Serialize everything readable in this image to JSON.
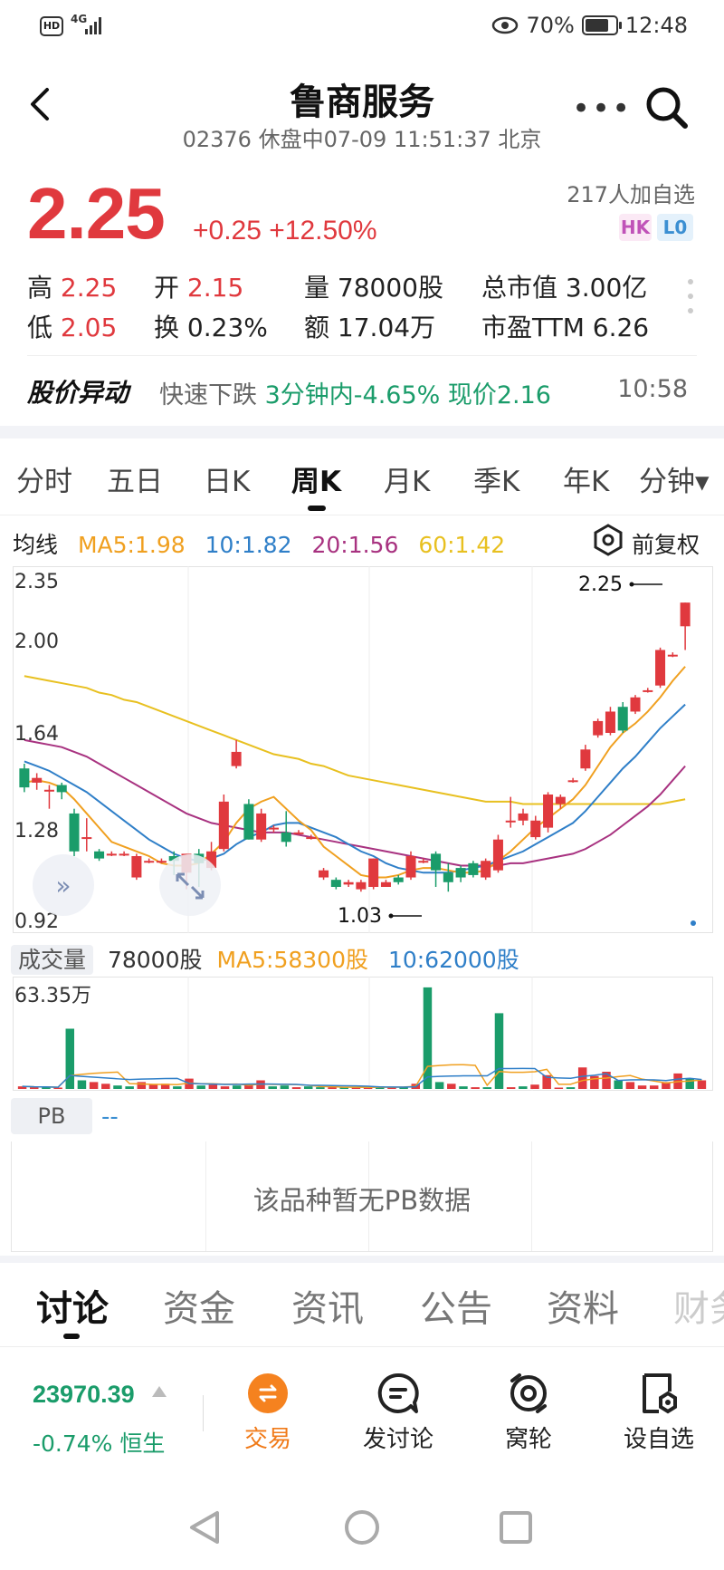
{
  "status_bar": {
    "hd": "HD",
    "network": "4G",
    "battery": "70%",
    "time": "12:48"
  },
  "header": {
    "title": "鲁商服务",
    "code": "02376",
    "trading_status": "休盘中07-09 11:51:37 北京"
  },
  "quote": {
    "price": "2.25",
    "change": "+0.25",
    "change_pct": "+12.50%",
    "watchers": "217人加自选",
    "tag_hk": "HK",
    "tag_lo": "L0",
    "high_label": "高",
    "high": "2.25",
    "open_label": "开",
    "open": "2.15",
    "volume_label": "量",
    "volume": "78000股",
    "mktcap_label": "总市值",
    "mktcap": "3.00亿",
    "low_label": "低",
    "low": "2.05",
    "turnover_label": "换",
    "turnover": "0.23%",
    "amount_label": "额",
    "amount": "17.04万",
    "pe_label": "市盈TTM",
    "pe": "6.26"
  },
  "alert": {
    "title": "股价异动",
    "type": "快速下跌",
    "detail": "3分钟内-4.65% 现价2.16",
    "time": "10:58"
  },
  "period_tabs": [
    "分时",
    "五日",
    "日K",
    "周K",
    "月K",
    "季K",
    "年K",
    "分钟▾"
  ],
  "active_period": "周K",
  "ma": {
    "label": "均线",
    "ma5": "MA5:1.98",
    "ma10": "10:1.82",
    "ma20": "20:1.56",
    "ma60": "60:1.42",
    "adjust": "前复权"
  },
  "colors": {
    "up": "#e0393e",
    "down": "#1a9c6a",
    "ma5": "#f0a020",
    "ma10": "#2f7fc8",
    "ma20": "#a83280",
    "ma60": "#e8c020"
  },
  "kline": {
    "y_labels": [
      "2.35",
      "2.00",
      "1.64",
      "1.28",
      "0.92"
    ],
    "high_marker": "2.25",
    "low_marker": "1.03",
    "ylim": [
      0.92,
      2.35
    ],
    "candles": [
      [
        1.55,
        1.47,
        1.57,
        1.45
      ],
      [
        1.49,
        1.51,
        1.53,
        1.46
      ],
      [
        1.46,
        1.46,
        1.48,
        1.38
      ],
      [
        1.48,
        1.45,
        1.49,
        1.42
      ],
      [
        1.36,
        1.2,
        1.38,
        1.18
      ],
      [
        1.26,
        1.26,
        1.34,
        1.2
      ],
      [
        1.2,
        1.17,
        1.21,
        1.16
      ],
      [
        1.19,
        1.19,
        1.2,
        1.18
      ],
      [
        1.19,
        1.19,
        1.2,
        1.18
      ],
      [
        1.09,
        1.18,
        1.19,
        1.08
      ],
      [
        1.16,
        1.16,
        1.17,
        1.15
      ],
      [
        1.16,
        1.16,
        1.17,
        1.15
      ],
      [
        1.18,
        1.16,
        1.2,
        1.1
      ],
      [
        1.11,
        1.19,
        1.19,
        1.04
      ],
      [
        1.19,
        1.15,
        1.21,
        1.05
      ],
      [
        1.13,
        1.2,
        1.24,
        1.12
      ],
      [
        1.21,
        1.41,
        1.44,
        1.2
      ],
      [
        1.56,
        1.62,
        1.67,
        1.55
      ],
      [
        1.4,
        1.25,
        1.42,
        1.25
      ],
      [
        1.25,
        1.36,
        1.38,
        1.24
      ],
      [
        1.3,
        1.3,
        1.31,
        1.28
      ],
      [
        1.28,
        1.24,
        1.37,
        1.22
      ],
      [
        1.28,
        1.28,
        1.29,
        1.27
      ],
      [
        1.26,
        1.26,
        1.27,
        1.25
      ],
      [
        1.09,
        1.12,
        1.13,
        1.08
      ],
      [
        1.08,
        1.05,
        1.09,
        1.04
      ],
      [
        1.06,
        1.07,
        1.08,
        1.05
      ],
      [
        1.04,
        1.07,
        1.08,
        1.03
      ],
      [
        1.05,
        1.17,
        1.17,
        1.04
      ],
      [
        1.05,
        1.07,
        1.08,
        1.05
      ],
      [
        1.09,
        1.07,
        1.1,
        1.06
      ],
      [
        1.09,
        1.18,
        1.2,
        1.08
      ],
      [
        1.16,
        1.16,
        1.17,
        1.15
      ],
      [
        1.19,
        1.12,
        1.2,
        1.05
      ],
      [
        1.11,
        1.07,
        1.15,
        1.03
      ],
      [
        1.13,
        1.09,
        1.14,
        1.07
      ],
      [
        1.15,
        1.1,
        1.16,
        1.09
      ],
      [
        1.09,
        1.16,
        1.17,
        1.08
      ],
      [
        1.12,
        1.25,
        1.27,
        1.11
      ],
      [
        1.33,
        1.33,
        1.43,
        1.3
      ],
      [
        1.33,
        1.36,
        1.38,
        1.31
      ],
      [
        1.26,
        1.33,
        1.35,
        1.25
      ],
      [
        1.3,
        1.44,
        1.45,
        1.28
      ],
      [
        1.4,
        1.43,
        1.44,
        1.38
      ],
      [
        1.5,
        1.5,
        1.51,
        1.49
      ],
      [
        1.55,
        1.63,
        1.65,
        1.54
      ],
      [
        1.69,
        1.75,
        1.76,
        1.68
      ],
      [
        1.7,
        1.79,
        1.81,
        1.69
      ],
      [
        1.81,
        1.71,
        1.83,
        1.7
      ],
      [
        1.79,
        1.85,
        1.86,
        1.78
      ],
      [
        1.88,
        1.88,
        1.89,
        1.87
      ],
      [
        1.9,
        2.05,
        2.06,
        1.89
      ],
      [
        2.03,
        2.03,
        2.04,
        2.02
      ],
      [
        2.15,
        2.25,
        2.25,
        2.05
      ]
    ],
    "ma5": [
      1.49,
      1.5,
      1.49,
      1.47,
      1.42,
      1.36,
      1.3,
      1.24,
      1.22,
      1.2,
      1.18,
      1.15,
      1.14,
      1.14,
      1.15,
      1.19,
      1.24,
      1.32,
      1.38,
      1.41,
      1.43,
      1.38,
      1.33,
      1.29,
      1.22,
      1.18,
      1.14,
      1.1,
      1.09,
      1.09,
      1.1,
      1.12,
      1.13,
      1.13,
      1.12,
      1.11,
      1.11,
      1.12,
      1.16,
      1.2,
      1.25,
      1.3,
      1.34,
      1.38,
      1.42,
      1.48,
      1.56,
      1.64,
      1.7,
      1.74,
      1.79,
      1.85,
      1.92,
      1.98
    ],
    "ma10": [
      1.58,
      1.56,
      1.54,
      1.51,
      1.48,
      1.45,
      1.41,
      1.37,
      1.33,
      1.29,
      1.25,
      1.22,
      1.19,
      1.17,
      1.16,
      1.17,
      1.19,
      1.23,
      1.26,
      1.28,
      1.31,
      1.32,
      1.32,
      1.3,
      1.28,
      1.26,
      1.23,
      1.2,
      1.18,
      1.15,
      1.13,
      1.12,
      1.11,
      1.11,
      1.11,
      1.12,
      1.13,
      1.14,
      1.16,
      1.18,
      1.2,
      1.23,
      1.26,
      1.29,
      1.32,
      1.37,
      1.43,
      1.49,
      1.55,
      1.6,
      1.66,
      1.72,
      1.77,
      1.82
    ],
    "ma20": [
      1.67,
      1.66,
      1.65,
      1.64,
      1.62,
      1.6,
      1.57,
      1.54,
      1.51,
      1.48,
      1.45,
      1.42,
      1.39,
      1.36,
      1.34,
      1.32,
      1.31,
      1.3,
      1.29,
      1.28,
      1.28,
      1.28,
      1.27,
      1.26,
      1.25,
      1.24,
      1.23,
      1.22,
      1.21,
      1.2,
      1.19,
      1.18,
      1.17,
      1.16,
      1.15,
      1.14,
      1.14,
      1.14,
      1.14,
      1.15,
      1.15,
      1.16,
      1.17,
      1.18,
      1.19,
      1.21,
      1.24,
      1.27,
      1.31,
      1.35,
      1.39,
      1.44,
      1.5,
      1.56
    ],
    "ma60": [
      1.94,
      1.93,
      1.92,
      1.91,
      1.9,
      1.89,
      1.87,
      1.86,
      1.84,
      1.83,
      1.81,
      1.79,
      1.77,
      1.75,
      1.73,
      1.71,
      1.69,
      1.67,
      1.65,
      1.63,
      1.61,
      1.6,
      1.59,
      1.57,
      1.56,
      1.54,
      1.52,
      1.51,
      1.5,
      1.49,
      1.48,
      1.47,
      1.46,
      1.45,
      1.44,
      1.43,
      1.42,
      1.41,
      1.41,
      1.41,
      1.4,
      1.4,
      1.4,
      1.4,
      1.4,
      1.4,
      1.4,
      1.4,
      1.4,
      1.4,
      1.4,
      1.4,
      1.41,
      1.42
    ]
  },
  "volume": {
    "label": "成交量",
    "value": "78000股",
    "ma5": "MA5:58300股",
    "ma10": "10:62000股",
    "max_label": "63.35万",
    "bars": [
      0.03,
      0.02,
      0.02,
      0.01,
      0.7,
      0.1,
      0.08,
      0.06,
      0.04,
      0.03,
      0.08,
      0.05,
      0.06,
      0.03,
      0.12,
      0.04,
      0.05,
      0.03,
      0.04,
      0.06,
      0.1,
      0.03,
      0.04,
      0.02,
      0.03,
      0.02,
      0.02,
      0.01,
      0.02,
      0.02,
      0.03,
      0.02,
      0.02,
      0.06,
      1.18,
      0.08,
      0.06,
      0.03,
      0.02,
      0.02,
      0.88,
      0.02,
      0.03,
      0.05,
      0.16,
      0.01,
      0.02,
      0.25,
      0.15,
      0.2,
      0.1,
      0.08,
      0.04,
      0.04,
      0.08,
      0.18,
      0.12,
      0.1
    ],
    "bar_up": [
      true,
      true,
      false,
      true,
      false,
      false,
      true,
      true,
      false,
      false,
      true,
      true,
      true,
      false,
      true,
      false,
      true,
      true,
      false,
      true,
      true,
      false,
      false,
      true,
      false,
      false,
      true,
      false,
      true,
      true,
      false,
      true,
      false,
      true,
      false,
      false,
      true,
      false,
      true,
      false,
      false,
      true,
      false,
      true,
      true,
      true,
      false,
      true,
      true,
      true,
      false,
      true,
      true,
      true,
      true,
      true,
      false,
      true
    ]
  },
  "pb": {
    "label": "PB",
    "value": "--",
    "empty": "该品种暂无PB数据"
  },
  "section_tabs": [
    "讨论",
    "资金",
    "资讯",
    "公告",
    "资料",
    "财务"
  ],
  "toolbar": {
    "index_value": "23970.39",
    "index_change": "-0.74% 恒生",
    "trade": "交易",
    "post": "发讨论",
    "wolun": "窝轮",
    "add_watch": "设自选"
  }
}
